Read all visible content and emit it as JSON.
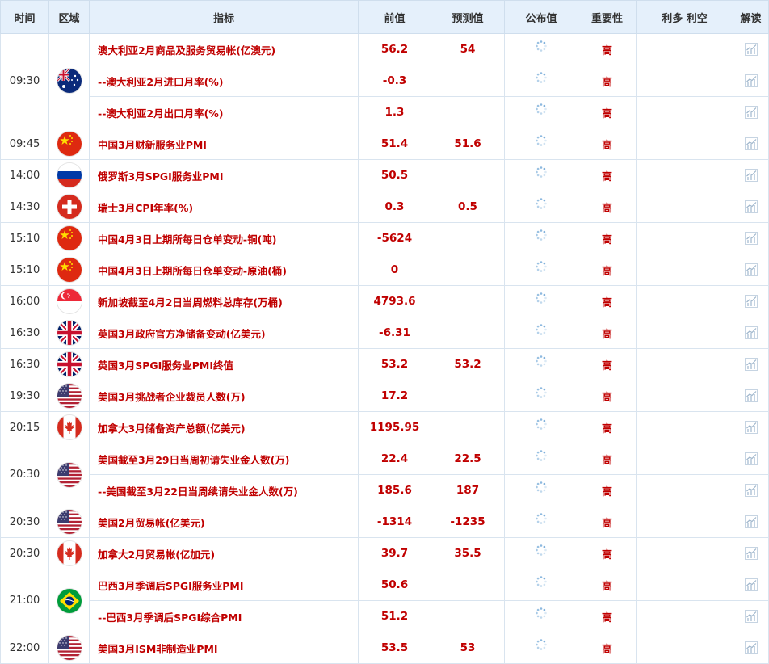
{
  "headers": {
    "time": "时间",
    "region": "区域",
    "indicator": "指标",
    "previous": "前值",
    "forecast": "预测值",
    "actual": "公布值",
    "importance": "重要性",
    "impact": "利多 利空",
    "analysis": "解读"
  },
  "groups": [
    {
      "time": "09:30",
      "country": "australia",
      "rows": [
        {
          "indicator": "澳大利亚2月商品及服务贸易帐(亿澳元)",
          "previous": "56.2",
          "forecast": "54",
          "importance": "高"
        },
        {
          "indicator": "--澳大利亚2月进口月率(%)",
          "previous": "-0.3",
          "forecast": "",
          "importance": "高"
        },
        {
          "indicator": "--澳大利亚2月出口月率(%)",
          "previous": "1.3",
          "forecast": "",
          "importance": "高"
        }
      ]
    },
    {
      "time": "09:45",
      "country": "china",
      "rows": [
        {
          "indicator": "中国3月财新服务业PMI",
          "previous": "51.4",
          "forecast": "51.6",
          "importance": "高"
        }
      ]
    },
    {
      "time": "14:00",
      "country": "russia",
      "rows": [
        {
          "indicator": "俄罗斯3月SPGI服务业PMI",
          "previous": "50.5",
          "forecast": "",
          "importance": "高"
        }
      ]
    },
    {
      "time": "14:30",
      "country": "switzerland",
      "rows": [
        {
          "indicator": "瑞士3月CPI年率(%)",
          "previous": "0.3",
          "forecast": "0.5",
          "importance": "高"
        }
      ]
    },
    {
      "time": "15:10",
      "country": "china",
      "rows": [
        {
          "indicator": "中国4月3日上期所每日仓单变动-铜(吨)",
          "previous": "-5624",
          "forecast": "",
          "importance": "高"
        }
      ]
    },
    {
      "time": "15:10",
      "country": "china",
      "rows": [
        {
          "indicator": "中国4月3日上期所每日仓单变动-原油(桶)",
          "previous": "0",
          "forecast": "",
          "importance": "高"
        }
      ]
    },
    {
      "time": "16:00",
      "country": "singapore",
      "rows": [
        {
          "indicator": "新加坡截至4月2日当周燃料总库存(万桶)",
          "previous": "4793.6",
          "forecast": "",
          "importance": "高"
        }
      ]
    },
    {
      "time": "16:30",
      "country": "uk",
      "rows": [
        {
          "indicator": "英国3月政府官方净储备变动(亿美元)",
          "previous": "-6.31",
          "forecast": "",
          "importance": "高"
        }
      ]
    },
    {
      "time": "16:30",
      "country": "uk",
      "rows": [
        {
          "indicator": "英国3月SPGI服务业PMI终值",
          "previous": "53.2",
          "forecast": "53.2",
          "importance": "高"
        }
      ]
    },
    {
      "time": "19:30",
      "country": "usa",
      "rows": [
        {
          "indicator": "美国3月挑战者企业裁员人数(万)",
          "previous": "17.2",
          "forecast": "",
          "importance": "高"
        }
      ]
    },
    {
      "time": "20:15",
      "country": "canada",
      "rows": [
        {
          "indicator": "加拿大3月储备资产总额(亿美元)",
          "previous": "1195.95",
          "forecast": "",
          "importance": "高"
        }
      ]
    },
    {
      "time": "20:30",
      "country": "usa",
      "rows": [
        {
          "indicator": "美国截至3月29日当周初请失业金人数(万)",
          "previous": "22.4",
          "forecast": "22.5",
          "importance": "高"
        },
        {
          "indicator": "--美国截至3月22日当周续请失业金人数(万)",
          "previous": "185.6",
          "forecast": "187",
          "importance": "高"
        }
      ]
    },
    {
      "time": "20:30",
      "country": "usa",
      "rows": [
        {
          "indicator": "美国2月贸易帐(亿美元)",
          "previous": "-1314",
          "forecast": "-1235",
          "importance": "高"
        }
      ]
    },
    {
      "time": "20:30",
      "country": "canada",
      "rows": [
        {
          "indicator": "加拿大2月贸易帐(亿加元)",
          "previous": "39.7",
          "forecast": "35.5",
          "importance": "高"
        }
      ]
    },
    {
      "time": "21:00",
      "country": "brazil",
      "rows": [
        {
          "indicator": "巴西3月季调后SPGI服务业PMI",
          "previous": "50.6",
          "forecast": "",
          "importance": "高"
        },
        {
          "indicator": "--巴西3月季调后SPGI综合PMI",
          "previous": "51.2",
          "forecast": "",
          "importance": "高"
        }
      ]
    },
    {
      "time": "22:00",
      "country": "usa",
      "rows": [
        {
          "indicator": "美国3月ISM非制造业PMI",
          "previous": "53.5",
          "forecast": "53",
          "importance": "高"
        }
      ]
    }
  ],
  "colors": {
    "accent": "#c00000",
    "header_bg": "#e5f0fb",
    "border": "#d9e4ef"
  },
  "icons": {
    "actual": "loading-spinner-icon",
    "analysis": "line-chart-icon"
  }
}
